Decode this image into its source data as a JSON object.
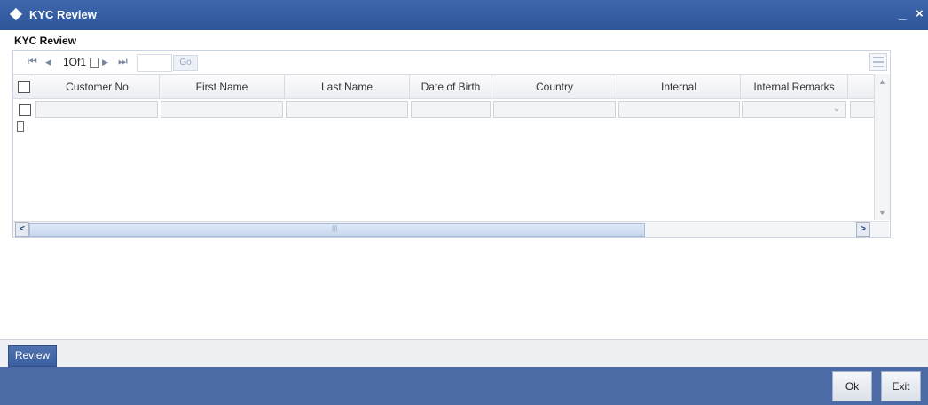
{
  "window": {
    "title": "KYC Review",
    "minimize_glyph": "_",
    "close_glyph": "×"
  },
  "section": {
    "title": "KYC Review"
  },
  "pager": {
    "first_glyph": "⏮",
    "prev_glyph": "◀",
    "page_text": "1Of1",
    "next_glyph": "▶",
    "last_glyph": "⏭",
    "page_input_value": "",
    "go_label": "Go"
  },
  "table": {
    "columns": [
      "Customer No",
      "First Name",
      "Last Name",
      "Date of Birth",
      "Country",
      "Internal",
      "Internal Remarks"
    ],
    "row": {
      "customer_no": "",
      "first_name": "",
      "last_name": "",
      "date_of_birth": "",
      "country": "",
      "internal": "",
      "internal_remarks": ""
    }
  },
  "actions": {
    "review_label": "Review"
  },
  "footer": {
    "ok_label": "Ok",
    "exit_label": "Exit"
  },
  "colors": {
    "title_bar": "#2e5598",
    "footer_bar": "#4b6aa6"
  },
  "icons": [
    "diamond-icon",
    "first-page-icon",
    "prev-page-icon",
    "next-page-icon",
    "last-page-icon",
    "grid-menu-icon",
    "dropdown-arrow-icon",
    "scroll-left-icon",
    "scroll-right-icon",
    "scroll-up-icon",
    "scroll-down-icon"
  ]
}
